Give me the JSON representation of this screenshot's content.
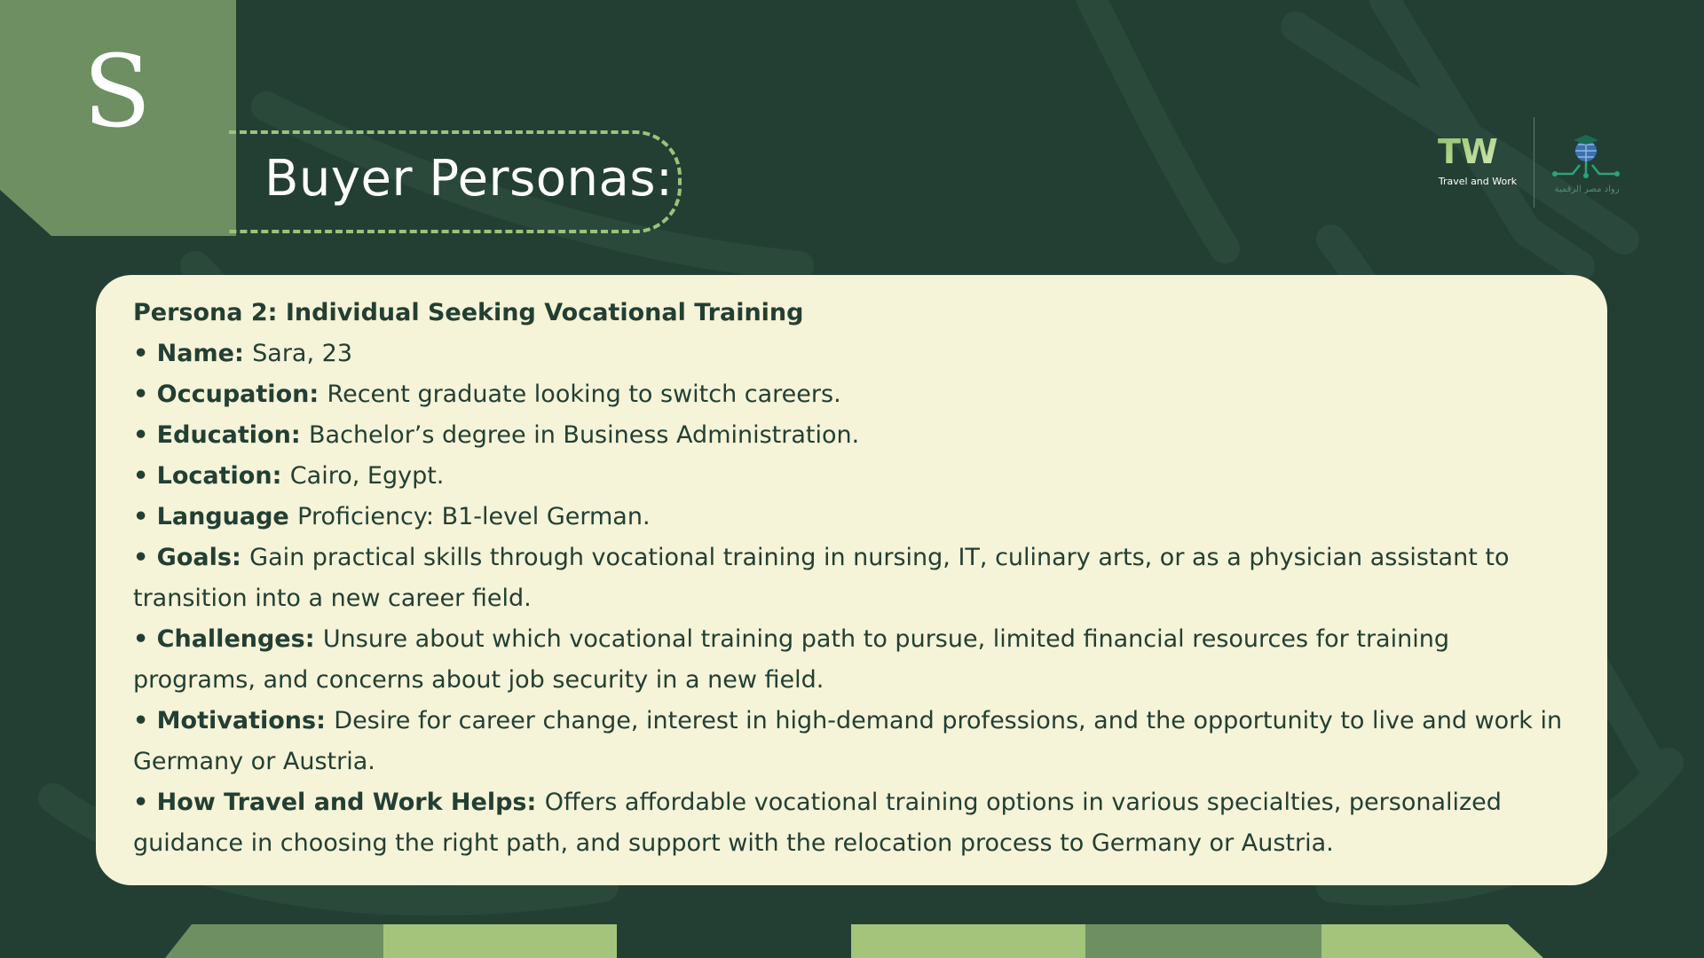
{
  "corner": {
    "letter": "S"
  },
  "title": "Buyer Personas:",
  "logos": {
    "tw_mark": "TW",
    "tw_caption": "Travel and Work",
    "partner_caption": "رواد مصر الرقمية"
  },
  "persona": {
    "heading": "Persona 2: Individual Seeking Vocational Training",
    "bullets": [
      {
        "label": "Name",
        "sep": ": ",
        "text": "Sara, 23"
      },
      {
        "label": "Occupation",
        "sep": ": ",
        "text": "Recent graduate looking to switch careers."
      },
      {
        "label": "Education",
        "sep": ": ",
        "text": "Bachelor’s degree in Business Administration."
      },
      {
        "label": "Location",
        "sep": ": ",
        "text": "Cairo, Egypt."
      },
      {
        "label": "Language",
        "sep": " ",
        "text": "Proficiency: B1-level German."
      },
      {
        "label": "Goals",
        "sep": ": ",
        "text": "Gain practical skills through vocational training in nursing, IT, culinary arts, or as a physician assistant to transition into a new career field."
      },
      {
        "label": "Challenges",
        "sep": ": ",
        "text": "Unsure about which vocational training path to pursue, limited financial resources for training programs, and concerns about job security in a new field."
      },
      {
        "label": "Motivations",
        "sep": ": ",
        "text": "Desire for career change, interest in high-demand professions, and the opportunity to live and work in Germany or Austria."
      },
      {
        "label": "How Travel and Work Helps",
        "sep": ": ",
        "text": "Offers affordable vocational training options in various specialties, personalized guidance in choosing the right path, and support with the relocation process to Germany or Austria."
      }
    ]
  },
  "colors": {
    "background": "#233f33",
    "corner_block": "#6d8f62",
    "accent_light": "#a3c47a",
    "card": "#f5f3d8",
    "text_dark": "#233f33",
    "dash_border": "#9dc27a"
  }
}
